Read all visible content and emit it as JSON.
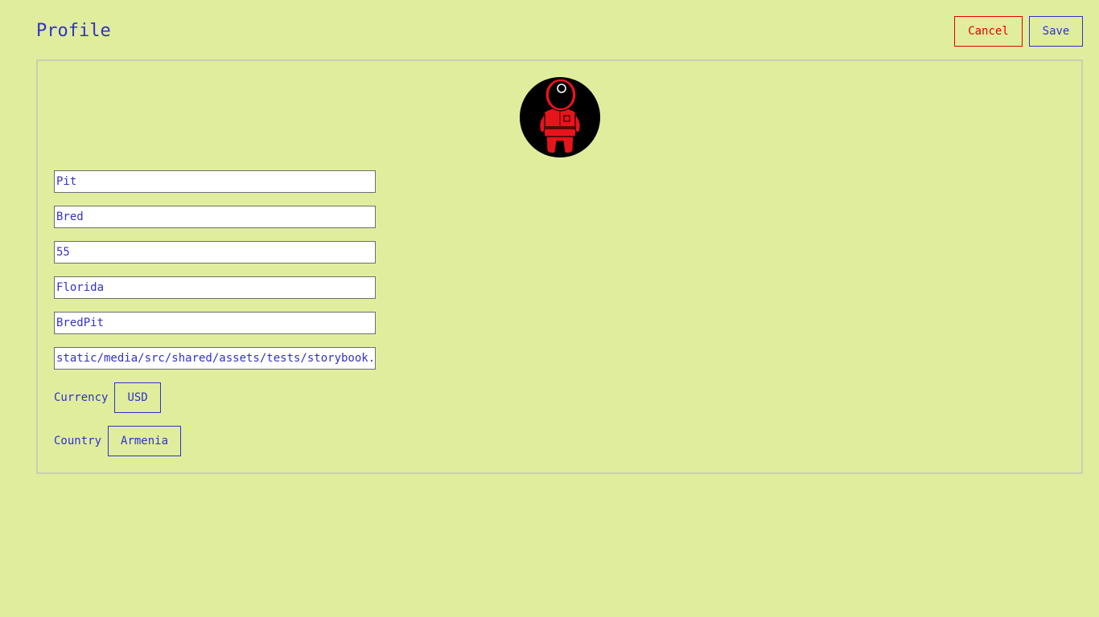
{
  "header": {
    "title": "Profile",
    "cancel_label": "Cancel",
    "save_label": "Save"
  },
  "form": {
    "first_name": "Pit",
    "last_name": "Bred",
    "age": "55",
    "location": "Florida",
    "username": "BredPit",
    "avatar_path": "static/media/src/shared/assets/tests/storybook.jpg",
    "currency_label": "Currency",
    "currency_value": "USD",
    "country_label": "Country",
    "country_value": "Armenia"
  },
  "colors": {
    "background": "#e0ed9d",
    "text": "#3232c8",
    "cancel": "#e60000",
    "card_border": "#c8cfb4"
  }
}
